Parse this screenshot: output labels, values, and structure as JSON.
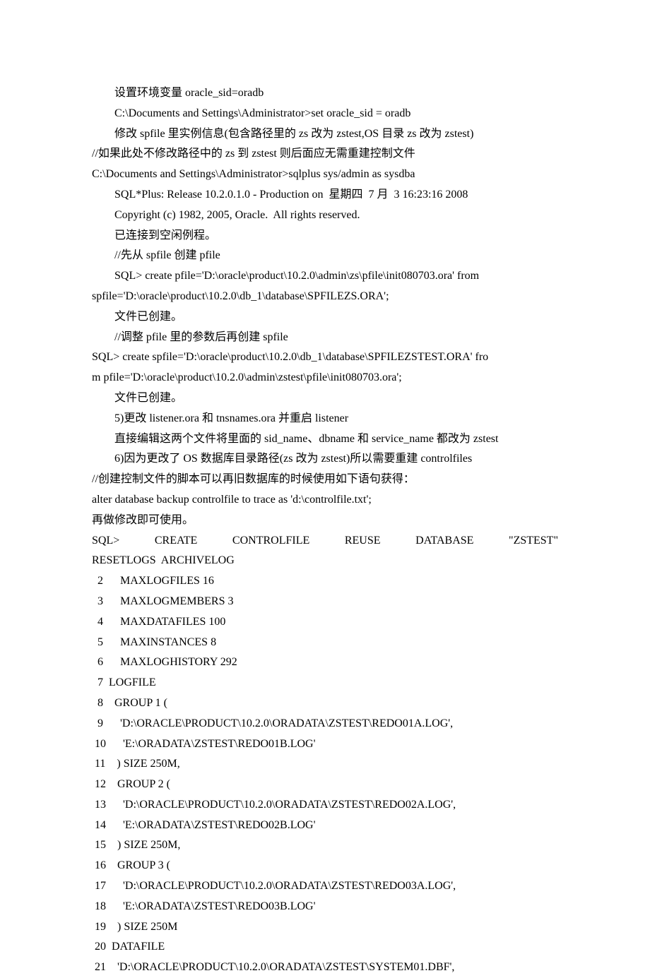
{
  "lines": [
    {
      "cls": "indent1",
      "text": "设置环境变量 oracle_sid=oradb"
    },
    {
      "cls": "indent1",
      "text": "C:\\Documents and Settings\\Administrator>set oracle_sid = oradb"
    },
    {
      "cls": "indent1",
      "text": "修改 spfile 里实例信息(包含路径里的 zs 改为 zstest,OS 目录 zs 改为 zstest)"
    },
    {
      "cls": "",
      "text": "//如果此处不修改路径中的 zs 到 zstest 则后面应无需重建控制文件"
    },
    {
      "cls": "",
      "text": "C:\\Documents and Settings\\Administrator>sqlplus sys/admin as sysdba"
    },
    {
      "cls": "indent1",
      "text": "SQL*Plus: Release 10.2.0.1.0 - Production on  星期四  7 月  3 16:23:16 2008"
    },
    {
      "cls": "indent1",
      "text": "Copyright (c) 1982, 2005, Oracle.  All rights reserved."
    },
    {
      "cls": "indent1",
      "text": "已连接到空闲例程。"
    },
    {
      "cls": "indent1",
      "text": "//先从 spfile 创建 pfile"
    },
    {
      "cls": "indent1",
      "text": "SQL> create pfile='D:\\oracle\\product\\10.2.0\\admin\\zs\\pfile\\init080703.ora' from"
    },
    {
      "cls": "",
      "text": "spfile='D:\\oracle\\product\\10.2.0\\db_1\\database\\SPFILEZS.ORA';"
    },
    {
      "cls": "indent1",
      "text": "文件已创建。"
    },
    {
      "cls": "indent1",
      "text": "//调整 pfile 里的参数后再创建 spfile"
    },
    {
      "cls": "",
      "text": "SQL> create spfile='D:\\oracle\\product\\10.2.0\\db_1\\database\\SPFILEZSTEST.ORA' fro"
    },
    {
      "cls": "",
      "text": "m pfile='D:\\oracle\\product\\10.2.0\\admin\\zstest\\pfile\\init080703.ora';"
    },
    {
      "cls": "indent1",
      "text": "文件已创建。"
    },
    {
      "cls": "indent1",
      "text": "5)更改 listener.ora 和 tnsnames.ora 并重启 listener"
    },
    {
      "cls": "indent1",
      "text": "直接编辑这两个文件将里面的 sid_name、dbname 和 service_name 都改为 zstest"
    },
    {
      "cls": "indent1",
      "text": "6)因为更改了 OS 数据库目录路径(zs 改为 zstest)所以需要重建 controlfiles"
    },
    {
      "cls": "",
      "text": "//创建控制文件的脚本可以再旧数据库的时候使用如下语句获得："
    },
    {
      "cls": "",
      "text": "alter database backup controlfile to trace as 'd:\\controlfile.txt';"
    },
    {
      "cls": "",
      "text": "再做修改即可使用。"
    },
    {
      "cls": "justify",
      "parts": [
        "SQL>",
        "CREATE",
        "CONTROLFILE",
        "REUSE",
        "DATABASE",
        "\"ZSTEST\""
      ]
    },
    {
      "cls": "",
      "text": "RESETLOGS  ARCHIVELOG"
    },
    {
      "cls": "",
      "text": "  2      MAXLOGFILES 16"
    },
    {
      "cls": "",
      "text": "  3      MAXLOGMEMBERS 3"
    },
    {
      "cls": "",
      "text": "  4      MAXDATAFILES 100"
    },
    {
      "cls": "",
      "text": "  5      MAXINSTANCES 8"
    },
    {
      "cls": "",
      "text": "  6      MAXLOGHISTORY 292"
    },
    {
      "cls": "",
      "text": "  7  LOGFILE"
    },
    {
      "cls": "",
      "text": "  8    GROUP 1 ("
    },
    {
      "cls": "",
      "text": "  9      'D:\\ORACLE\\PRODUCT\\10.2.0\\ORADATA\\ZSTEST\\REDO01A.LOG',"
    },
    {
      "cls": "",
      "text": " 10      'E:\\ORADATA\\ZSTEST\\REDO01B.LOG'"
    },
    {
      "cls": "",
      "text": " 11    ) SIZE 250M,"
    },
    {
      "cls": "",
      "text": " 12    GROUP 2 ("
    },
    {
      "cls": "",
      "text": " 13      'D:\\ORACLE\\PRODUCT\\10.2.0\\ORADATA\\ZSTEST\\REDO02A.LOG',"
    },
    {
      "cls": "",
      "text": " 14      'E:\\ORADATA\\ZSTEST\\REDO02B.LOG'"
    },
    {
      "cls": "",
      "text": " 15    ) SIZE 250M,"
    },
    {
      "cls": "",
      "text": " 16    GROUP 3 ("
    },
    {
      "cls": "",
      "text": " 17      'D:\\ORACLE\\PRODUCT\\10.2.0\\ORADATA\\ZSTEST\\REDO03A.LOG',"
    },
    {
      "cls": "",
      "text": " 18      'E:\\ORADATA\\ZSTEST\\REDO03B.LOG'"
    },
    {
      "cls": "",
      "text": " 19    ) SIZE 250M"
    },
    {
      "cls": "",
      "text": " 20  DATAFILE"
    },
    {
      "cls": "",
      "text": " 21    'D:\\ORACLE\\PRODUCT\\10.2.0\\ORADATA\\ZSTEST\\SYSTEM01.DBF',"
    }
  ]
}
